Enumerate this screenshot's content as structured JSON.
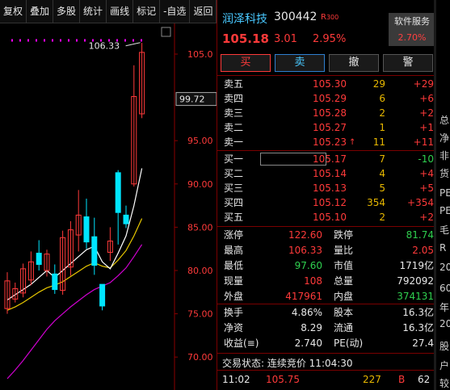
{
  "toolbar": [
    "复权",
    "叠加",
    "多股",
    "统计",
    "画线",
    "标记",
    "-自选",
    "返回"
  ],
  "chart": {
    "candles": [
      {
        "o": 75.6,
        "h": 79.8,
        "l": 75.0,
        "c": 78.8
      },
      {
        "o": 76.7,
        "h": 78.6,
        "l": 76.3,
        "c": 77.9
      },
      {
        "o": 77.4,
        "h": 80.8,
        "l": 76.9,
        "c": 80.2
      },
      {
        "o": 78.9,
        "h": 82.2,
        "l": 78.3,
        "c": 81.0
      },
      {
        "o": 82.0,
        "h": 83.5,
        "l": 80.0,
        "c": 80.7
      },
      {
        "o": 80.0,
        "h": 82.4,
        "l": 79.3,
        "c": 81.9
      },
      {
        "o": 79.6,
        "h": 80.7,
        "l": 77.3,
        "c": 77.8
      },
      {
        "o": 77.7,
        "h": 84.6,
        "l": 77.2,
        "c": 83.8
      },
      {
        "o": 80.4,
        "h": 85.7,
        "l": 79.4,
        "c": 84.7
      },
      {
        "o": 84.1,
        "h": 89.3,
        "l": 82.2,
        "c": 86.4
      },
      {
        "o": 86.2,
        "h": 88.3,
        "l": 82.5,
        "c": 83.3
      },
      {
        "o": 83.9,
        "h": 86.1,
        "l": 79.5,
        "c": 80.6
      },
      {
        "o": 78.4,
        "h": 78.4,
        "l": 75.4,
        "c": 75.9
      },
      {
        "o": 82.1,
        "h": 85.0,
        "l": 81.1,
        "c": 83.4
      },
      {
        "o": 91.3,
        "h": 91.6,
        "l": 83.0,
        "c": 86.7
      },
      {
        "o": 86.4,
        "h": 87.5,
        "l": 84.9,
        "c": 85.4
      },
      {
        "o": 90.0,
        "h": 103.7,
        "l": 89.7,
        "c": 100.1
      },
      {
        "o": 98.1,
        "h": 106.3,
        "l": 97.6,
        "c": 105.2
      }
    ],
    "ma5": [
      76.6,
      77.2,
      77.8,
      78.4,
      79.2,
      80.0,
      79.2,
      80.0,
      80.8,
      81.6,
      82.4,
      82.8,
      81.0,
      80.2,
      82.0,
      84.0,
      87.5,
      91.8
    ],
    "ma10": [
      75.4,
      75.8,
      76.3,
      76.9,
      77.5,
      78.0,
      78.3,
      78.7,
      79.3,
      79.9,
      80.5,
      80.9,
      80.5,
      80.3,
      81.2,
      82.3,
      84.0,
      86.0
    ],
    "ma20": [
      67.5,
      68.5,
      69.6,
      70.8,
      72.0,
      73.2,
      74.2,
      75.0,
      75.8,
      76.5,
      77.2,
      77.8,
      78.2,
      78.6,
      79.4,
      80.3,
      81.6,
      83.0
    ],
    "axis_labels": [
      "105.0",
      "95.00",
      "90.00",
      "85.00",
      "80.00",
      "75.00",
      "70.00"
    ],
    "current_price_label": "99.72",
    "high_marker": "106.33"
  },
  "quote": {
    "name": "润泽科技",
    "code": "300442",
    "r_badge": "R",
    "r_badge_sub": "300",
    "price": "105.18",
    "change": "3.01",
    "change_pct": "2.95%",
    "sector_name": "软件服务",
    "sector_change": "2.70%"
  },
  "actions": {
    "buy": "买",
    "sell": "卖",
    "cancel": "撤",
    "alert": "警"
  },
  "asks": [
    {
      "label": "卖五",
      "price": "105.30",
      "vol": "29",
      "delta": "+29",
      "dir": "up"
    },
    {
      "label": "卖四",
      "price": "105.29",
      "vol": "6",
      "delta": "+6",
      "dir": "up"
    },
    {
      "label": "卖三",
      "price": "105.28",
      "vol": "2",
      "delta": "+2",
      "dir": "up"
    },
    {
      "label": "卖二",
      "price": "105.27",
      "vol": "1",
      "delta": "+1",
      "dir": "up"
    },
    {
      "label": "卖一",
      "price": "105.23",
      "vol": "11",
      "delta": "+11",
      "dir": "up"
    }
  ],
  "bids": [
    {
      "label": "买一",
      "price": "105.17",
      "vol": "7",
      "delta": "-10",
      "dir": "down"
    },
    {
      "label": "买二",
      "price": "105.14",
      "vol": "4",
      "delta": "+4",
      "dir": "up"
    },
    {
      "label": "买三",
      "price": "105.13",
      "vol": "5",
      "delta": "+5",
      "dir": "up"
    },
    {
      "label": "买四",
      "price": "105.12",
      "vol": "354",
      "delta": "+354",
      "dir": "up"
    },
    {
      "label": "买五",
      "price": "105.10",
      "vol": "2",
      "delta": "+2",
      "dir": "up"
    }
  ],
  "stats": [
    {
      "l1": "涨停",
      "v1": "122.60",
      "c1": "up",
      "l2": "跌停",
      "v2": "81.74",
      "c2": "down"
    },
    {
      "l1": "最高",
      "v1": "106.33",
      "c1": "up",
      "l2": "量比",
      "v2": "2.05",
      "c2": "up"
    },
    {
      "l1": "最低",
      "v1": "97.60",
      "c1": "down",
      "l2": "市值",
      "v2": "1719亿",
      "c2": "white"
    },
    {
      "l1": "现量",
      "v1": "108",
      "c1": "up",
      "l2": "总量",
      "v2": "792092",
      "c2": "white"
    },
    {
      "l1": "外盘",
      "v1": "417961",
      "c1": "up",
      "l2": "内盘",
      "v2": "374131",
      "c2": "down"
    }
  ],
  "stats2": [
    {
      "l1": "换手",
      "v1": "4.86%",
      "c1": "white",
      "l2": "股本",
      "v2": "16.3亿",
      "c2": "white"
    },
    {
      "l1": "净资",
      "v1": "8.29",
      "c1": "white",
      "l2": "流通",
      "v2": "16.3亿",
      "c2": "white"
    },
    {
      "l1": "收益(≡)",
      "v1": "2.740",
      "c1": "white",
      "l2": "PE(动)",
      "v2": "27.4",
      "c2": "white"
    }
  ],
  "status_text": "交易状态: 连续竞价 11:04:30",
  "trades": [
    {
      "time": "11:02",
      "price": "105.75",
      "vol": "227",
      "side": "B",
      "count": "62"
    }
  ],
  "edge_glyphs": [
    "总",
    "净",
    "非",
    "货",
    "PE",
    "PE",
    "毛",
    "R",
    "20",
    "60",
    "年",
    "20",
    "股",
    "户",
    "较"
  ]
}
